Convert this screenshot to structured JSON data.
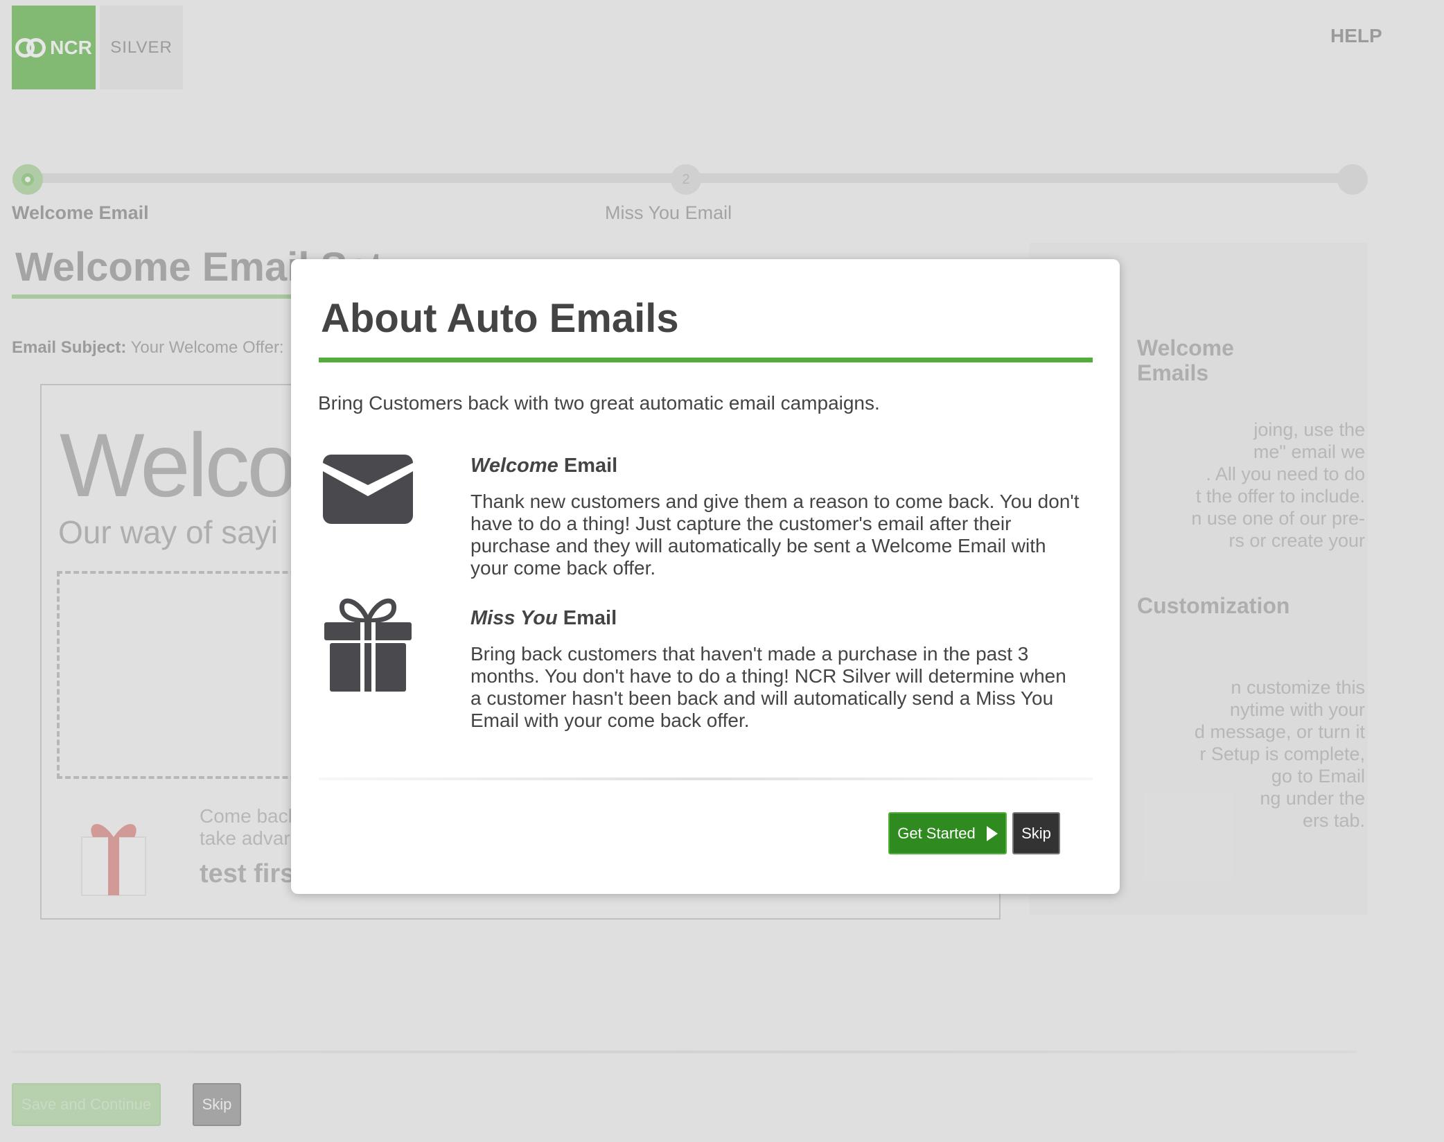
{
  "header": {
    "logo_ncr": "NCR",
    "logo_silver": "SILVER",
    "help_label": "HELP"
  },
  "progress": {
    "steps": [
      {
        "label": "Welcome Email",
        "number": ""
      },
      {
        "label": "Miss You Email",
        "number": "2"
      }
    ]
  },
  "background": {
    "page_title": "Welcome Email Set",
    "email_subject_label": "Email Subject:",
    "email_subject_value": "Your Welcome Offer:",
    "preview_welcome": "Welco",
    "preview_sub": "Our way of sayi",
    "preview_come_back_line1": "Come bacl",
    "preview_come_back_line2": "take advar",
    "preview_test": "test firs",
    "side_heading_1": "Welcome\nEmails",
    "side_text_1": "joing, use the\nme\" email we\n. All you need to do\nt the offer to include.\nn use one of our pre-\nrs or create your",
    "side_heading_2": "Customization",
    "side_text_2": "n customize this\nnytime with your\nd message, or turn it\nr Setup is complete,\ngo to Email\nng under the\ners tab.",
    "save_continue_label": "Save and Continue",
    "skip_label": "Skip"
  },
  "modal": {
    "title": "About Auto Emails",
    "intro": "Bring Customers back with two great automatic email campaigns.",
    "sections": [
      {
        "icon": "envelope-icon",
        "title_italic": "Welcome",
        "title_rest": " Email",
        "body": "Thank new customers and give them a reason to come back. You don't have to do a thing! Just capture the customer's email after their purchase and they will automatically be sent a Welcome Email with your come back offer."
      },
      {
        "icon": "gift-icon",
        "title_italic": "Miss You",
        "title_rest": " Email",
        "body": "Bring back customers that haven't made a purchase in the past 3 months. You don't have to do a thing! NCR Silver will determine when a customer hasn't been back and will automatically send a Miss You Email with your come back offer."
      }
    ],
    "get_started_label": "Get Started",
    "skip_label": "Skip"
  },
  "colors": {
    "brand_green": "#52ad3b",
    "button_green": "#2f8a1f",
    "button_dark": "#333333"
  }
}
